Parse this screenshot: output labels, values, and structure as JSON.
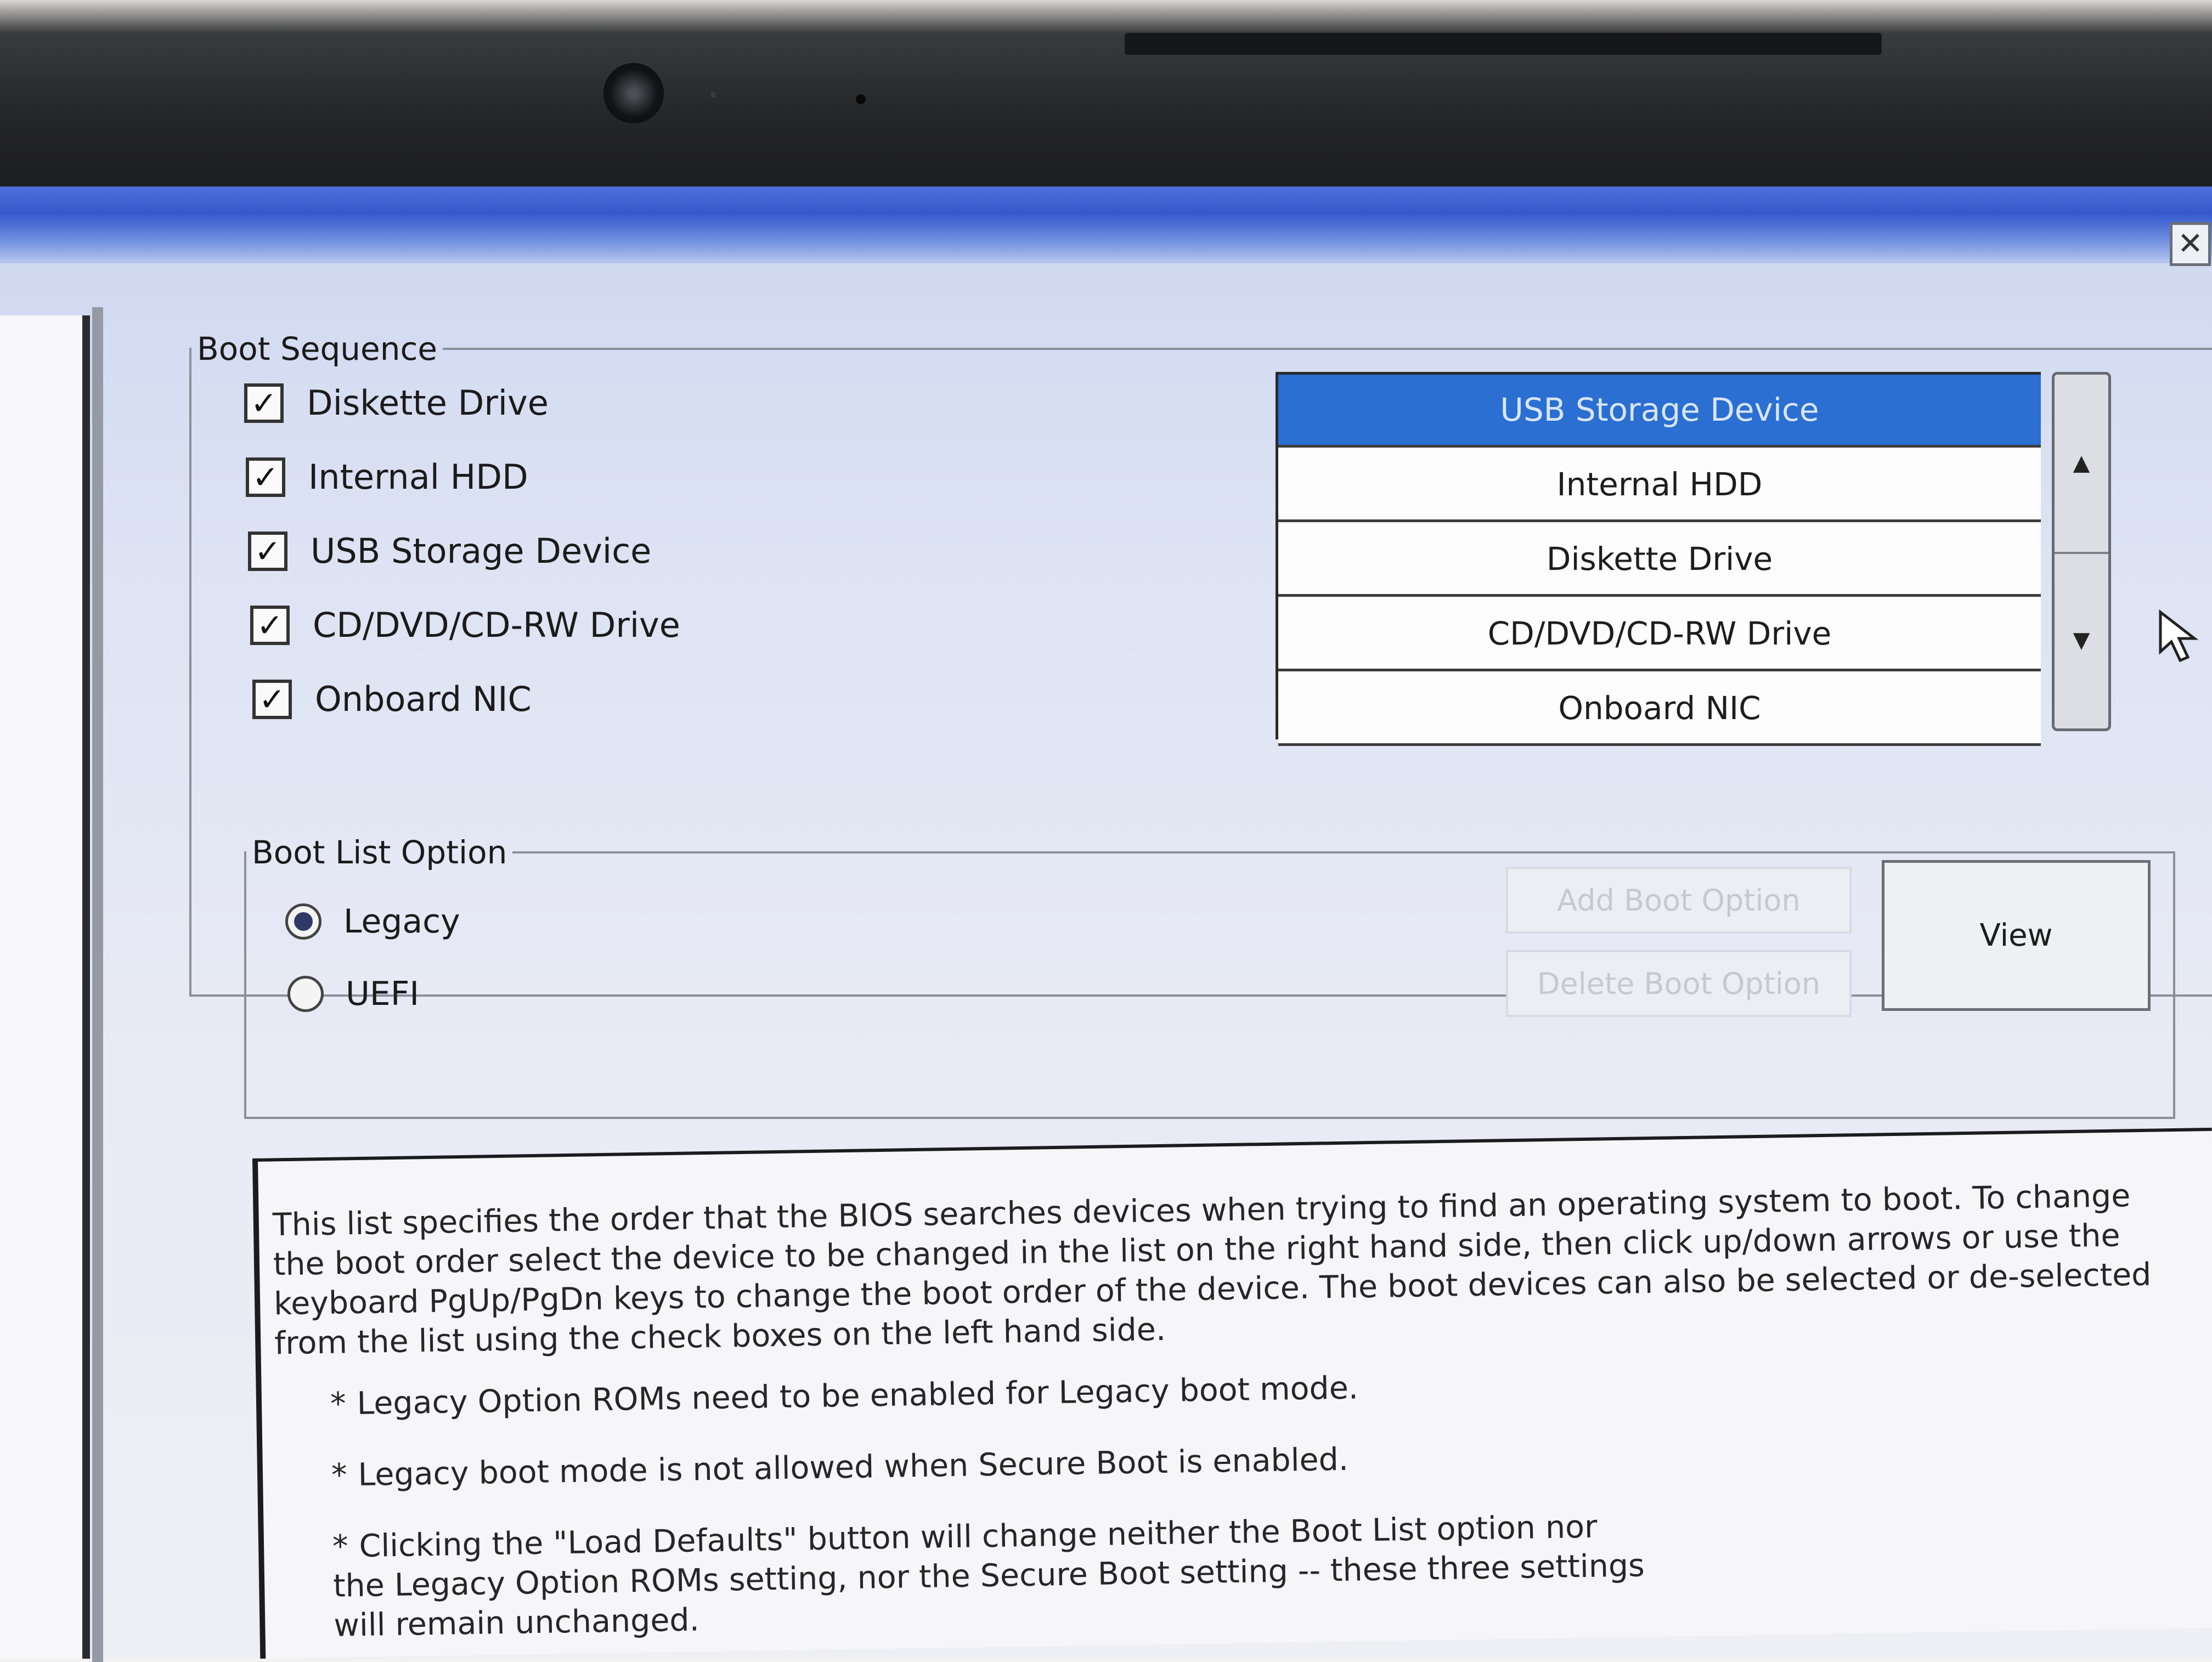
{
  "boot_sequence": {
    "title": "Boot Sequence",
    "devices": [
      {
        "label": "Diskette Drive",
        "checked": true
      },
      {
        "label": "Internal HDD",
        "checked": true
      },
      {
        "label": "USB Storage Device",
        "checked": true
      },
      {
        "label": "CD/DVD/CD-RW Drive",
        "checked": true
      },
      {
        "label": "Onboard NIC",
        "checked": true
      }
    ],
    "order": [
      {
        "label": "USB Storage Device",
        "selected": true
      },
      {
        "label": "Internal HDD",
        "selected": false
      },
      {
        "label": "Diskette Drive",
        "selected": false
      },
      {
        "label": "CD/DVD/CD-RW Drive",
        "selected": false
      },
      {
        "label": "Onboard NIC",
        "selected": false
      }
    ],
    "scroll_up_icon": "triangle-up-icon",
    "scroll_down_icon": "triangle-down-icon"
  },
  "boot_list_option": {
    "title": "Boot List Option",
    "options": [
      {
        "label": "Legacy",
        "selected": true
      },
      {
        "label": "UEFI",
        "selected": false
      }
    ],
    "add_button": "Add Boot Option",
    "delete_button": "Delete Boot Option",
    "view_button": "View"
  },
  "help": {
    "paragraph": "This list specifies the order that the BIOS searches devices when trying to find an operating system to boot. To change the boot order select the device to be changed in the list on the right hand side, then click up/down arrows or use the keyboard PgUp/PgDn keys to change the boot order of the device. The boot devices can also be selected or de-selected from the list using the check boxes on the left hand side.",
    "bullets": [
      "Legacy Option ROMs need to be enabled for Legacy boot mode.",
      "Legacy boot mode is not allowed when Secure Boot is enabled.",
      "Clicking the \"Load Defaults\" button will change neither the Boot List option nor the Legacy Option ROMs setting, nor the Secure Boot setting -- these three settings will remain unchanged."
    ]
  },
  "window": {
    "close_label": "✕"
  },
  "colors": {
    "selection": "#2a6fd1",
    "titlebar": "#3459cc"
  }
}
